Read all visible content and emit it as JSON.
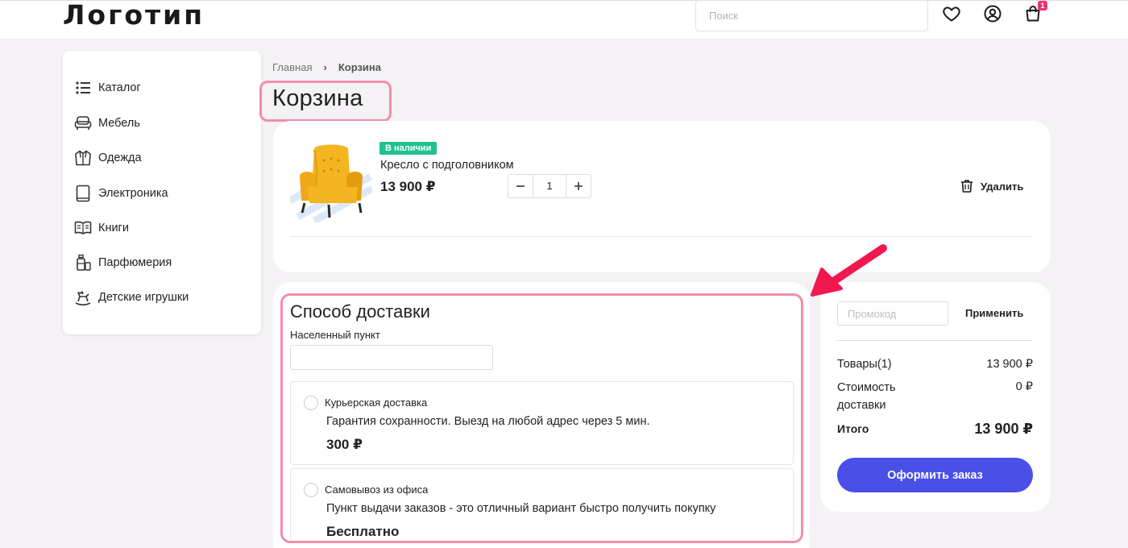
{
  "header": {
    "logo": "Логотип",
    "search_placeholder": "Поиск",
    "cart_count": "1"
  },
  "sidebar": {
    "items": [
      {
        "label": "Каталог",
        "icon": "list-icon"
      },
      {
        "label": "Мебель",
        "icon": "sofa-icon"
      },
      {
        "label": "Одежда",
        "icon": "jacket-icon"
      },
      {
        "label": "Электроника",
        "icon": "tablet-icon"
      },
      {
        "label": "Книги",
        "icon": "book-icon"
      },
      {
        "label": "Парфюмерия",
        "icon": "perfume-icon"
      },
      {
        "label": "Детские игрушки",
        "icon": "rocking-horse-icon"
      }
    ]
  },
  "breadcrumb": {
    "home": "Главная",
    "separator": "›",
    "current": "Корзина"
  },
  "page_title": "Корзина",
  "cart_item": {
    "badge": "В наличии",
    "name": "Кресло с подголовником",
    "price": "13 900 ₽",
    "quantity": "1",
    "delete_label": "Удалить"
  },
  "delivery": {
    "title": "Способ доставки",
    "city_label": "Населенный пункт",
    "options": [
      {
        "name": "Курьерская доставка",
        "description": "Гарантия сохранности. Выезд на любой адрес через 5 мин.",
        "price": "300 ₽"
      },
      {
        "name": "Самовывоз из офиса",
        "description": "Пункт выдачи заказов - это отличный вариант быстро получить покупку",
        "price": "Бесплатно"
      }
    ]
  },
  "summary": {
    "promo_placeholder": "Промокод",
    "apply_label": "Применить",
    "goods_label": "Товары(1)",
    "goods_value": "13 900 ₽",
    "delivery_label": "Стоимость доставки",
    "delivery_value": "0 ₽",
    "total_label": "Итого",
    "total_value": "13 900 ₽",
    "order_button": "Оформить заказ"
  },
  "colors": {
    "accent": "#4a4fe8",
    "badge_green": "#1fc18f",
    "highlight_pink": "#f28ea9",
    "arrow_red": "#f0184f",
    "cart_badge": "#e8336f"
  }
}
